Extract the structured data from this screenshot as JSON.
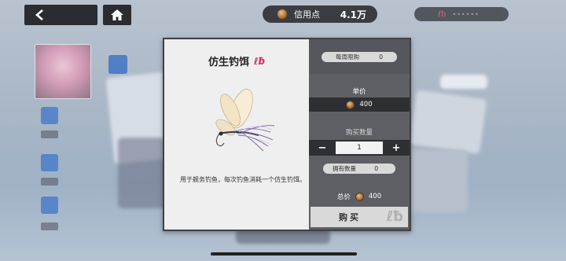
{
  "header": {
    "credit_label": "信用点",
    "credit_value": "4.1万"
  },
  "item": {
    "name": "仿生钓饵",
    "description": "用于舰务钓鱼，每次钓鱼消耗一个仿生钓饵。"
  },
  "shop": {
    "weekly_limit_label": "每周限购",
    "weekly_limit_value": "0",
    "unit_price_label": "单价",
    "unit_price_value": "400",
    "quantity_label": "购买数量",
    "minus_label": "−",
    "plus_label": "+",
    "quantity_value": "1",
    "owned_label": "拥有数量",
    "owned_value": "0",
    "total_label": "总价",
    "total_value": "400",
    "buy_label": "购买"
  },
  "colors": {
    "dialog_dark": "#5d5f64",
    "accent_pink": "#c8306a",
    "coin": "#a86e3a"
  }
}
